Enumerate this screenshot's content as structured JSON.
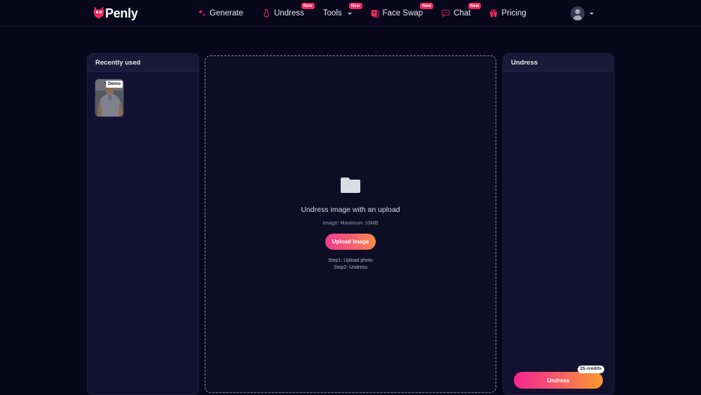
{
  "header": {
    "logo": {
      "text": "Penly",
      "icon": "devil-head-icon"
    },
    "nav": [
      {
        "label": "Generate",
        "icon": "sparkle-icon",
        "badge": null,
        "caret": false
      },
      {
        "label": "Undress",
        "icon": "dress-icon",
        "badge": "New",
        "caret": false
      },
      {
        "label": "Tools",
        "icon": null,
        "badge": "New",
        "caret": true
      },
      {
        "label": "Face Swap",
        "icon": "face-swap-icon",
        "badge": "New",
        "caret": false
      },
      {
        "label": "Chat",
        "icon": "chat-bubble-icon",
        "badge": "New",
        "caret": false
      },
      {
        "label": "Pricing",
        "icon": "gift-icon",
        "badge": null,
        "caret": false
      }
    ],
    "account": {
      "icon": "user-avatar-icon",
      "caret": true
    }
  },
  "sidebar": {
    "title": "Recently used",
    "items": [
      {
        "badge": "Demo",
        "alt": "demo-photo-man-gray-shirt"
      }
    ]
  },
  "dropzone": {
    "folder_icon": "folder-icon",
    "title": "Undress image with an upload",
    "subtitle": "Image: Maximum 10MB",
    "upload_label": "Upload Image",
    "step1": "Step1: Upload photo",
    "step2": "Step2: Undress"
  },
  "rightpanel": {
    "title": "Undress",
    "action_label": "Undress",
    "credits": "25 credits"
  },
  "colors": {
    "background": "#08071c",
    "panel": "#121230",
    "panel_header": "#1a1a38",
    "accent_pink": "#f2295b",
    "gradient_start": "#f5258f",
    "gradient_end": "#fc9a2a",
    "text_primary": "#e9e9f2",
    "text_muted": "#9a9ab0"
  }
}
